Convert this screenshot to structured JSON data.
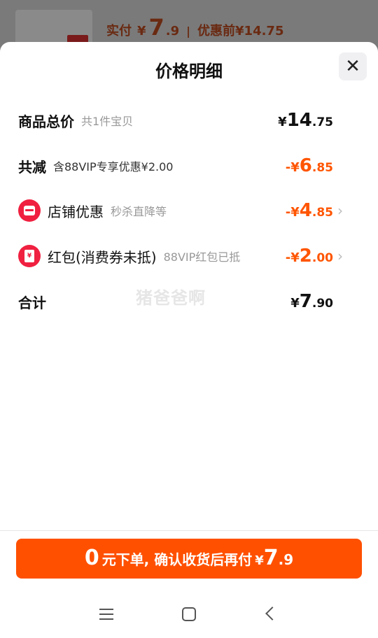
{
  "background": {
    "paid_label": "实付",
    "paid_yen": "¥",
    "paid_int": "7",
    "paid_dec": ".9",
    "separator": "|",
    "original_label": "优惠前¥14.75"
  },
  "sheet": {
    "title": "价格明细",
    "close_icon": "close-icon"
  },
  "rows": {
    "total": {
      "label": "商品总价",
      "sub": "共1件宝贝",
      "yen": "¥",
      "int": "14",
      "dec": ".75"
    },
    "reduction": {
      "label": "共减",
      "sub": "含88VIP专享优惠¥2.00",
      "yen": "-¥",
      "int": "6",
      "dec": ".85"
    },
    "shop": {
      "icon": "shop-icon",
      "label": "店铺优惠",
      "sub": "秒杀直降等",
      "yen": "-¥",
      "int": "4",
      "dec": ".85",
      "chevron": "›"
    },
    "redpacket": {
      "icon": "red-packet-icon",
      "icon_glyph": "¥",
      "label": "红包(消费券未抵)",
      "sub": "88VIP红包已抵",
      "yen": "-¥",
      "int": "2",
      "dec": ".00",
      "chevron": "›"
    },
    "sum": {
      "label": "合计",
      "yen": "¥",
      "int": "7",
      "dec": ".90"
    }
  },
  "watermark": "猪爸爸啊",
  "pay_button": {
    "big": "0",
    "text": "元下单, 确认收货后再付",
    "yen": "¥",
    "int": "7",
    "dec": ".9"
  },
  "navbar": {
    "menu_icon": "menu-icon",
    "home_icon": "home-icon",
    "back_icon": "back-icon"
  },
  "colors": {
    "accent": "#ff5000",
    "discount": "#ff5500",
    "icon_red": "#f02040"
  }
}
